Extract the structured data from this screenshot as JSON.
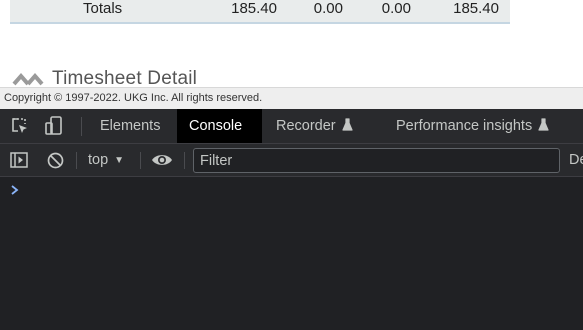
{
  "page": {
    "totals": {
      "label": "Totals",
      "v1": "185.40",
      "v2": "0.00",
      "v3": "0.00",
      "v4": "185.40"
    },
    "detail_title": "Timesheet Detail",
    "copyright": "Copyright © 1997-2022. UKG Inc. All rights reserved."
  },
  "devtools": {
    "tabs": [
      {
        "label": "Elements",
        "active": false
      },
      {
        "label": "Console",
        "active": true
      },
      {
        "label": "Recorder",
        "active": false
      },
      {
        "label": "Performance insights",
        "active": false
      }
    ],
    "context": "top",
    "filter_placeholder": "Filter",
    "levels_partial": "De",
    "icons": [
      "inspect-element-icon",
      "device-toolbar-icon",
      "sidebar-toggle-icon",
      "clear-console-icon",
      "eye-icon",
      "flask-icon",
      "prompt-chevron-icon"
    ],
    "colors": {
      "panel_bg": "#202124",
      "toolbar_bg": "#292a2d",
      "active_tab_bg": "#000000",
      "prompt": "#8ab4f8"
    }
  }
}
